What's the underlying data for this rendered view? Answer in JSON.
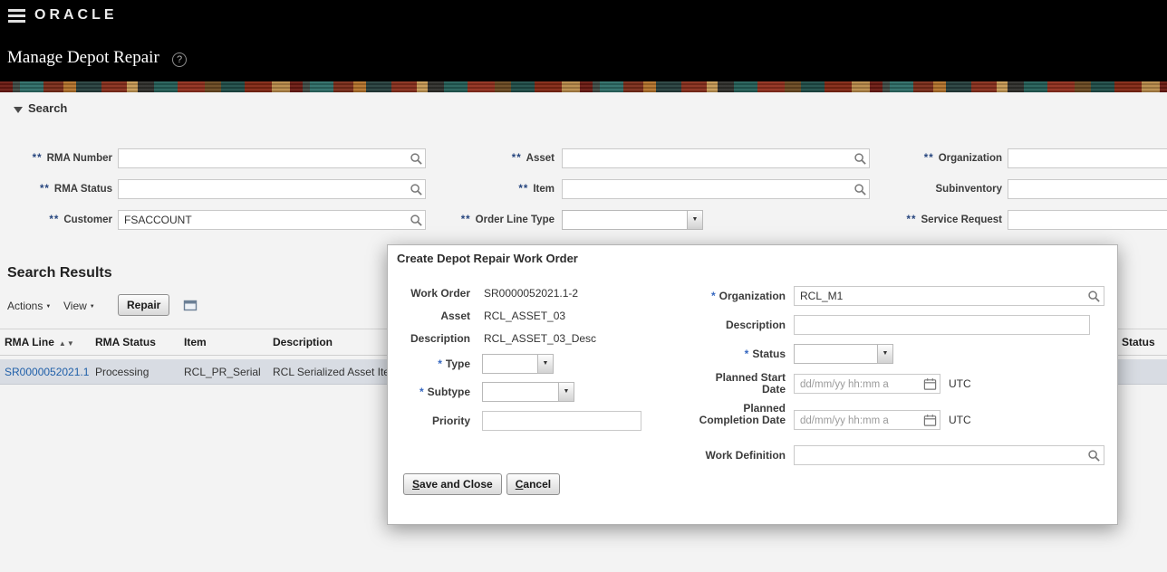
{
  "icons": {
    "help": "?",
    "sort_asc": "▲",
    "sort_desc": "▼",
    "dropdown_arrow": "▼",
    "menu_arrow": "▼"
  },
  "topbar": {
    "brand": "ORACLE"
  },
  "header": {
    "title": "Manage Depot Repair"
  },
  "search": {
    "title": "Search",
    "fields": {
      "rma_number": {
        "marker": "**",
        "label": "RMA Number",
        "value": ""
      },
      "rma_status": {
        "marker": "**",
        "label": "RMA Status",
        "value": ""
      },
      "customer": {
        "marker": "**",
        "label": "Customer",
        "value": "FSACCOUNT"
      },
      "asset": {
        "marker": "**",
        "label": "Asset",
        "value": ""
      },
      "item": {
        "marker": "**",
        "label": "Item",
        "value": ""
      },
      "order_line_type": {
        "marker": "**",
        "label": "Order Line Type",
        "value": ""
      },
      "organization": {
        "marker": "**",
        "label": "Organization",
        "value": ""
      },
      "subinventory": {
        "marker": "",
        "label": "Subinventory",
        "value": ""
      },
      "service_request": {
        "marker": "**",
        "label": "Service Request",
        "value": ""
      }
    }
  },
  "results": {
    "title": "Search Results",
    "toolbar": {
      "actions": "Actions",
      "view": "View",
      "repair": "Repair"
    },
    "table": {
      "headers": {
        "rma_line": "RMA Line",
        "rma_status": "RMA Status",
        "item": "Item",
        "description": "Description",
        "status": "Status"
      },
      "row": {
        "rma_line": "SR0000052021.1",
        "rma_status": "Processing",
        "item": "RCL_PR_Serial",
        "description": "RCL Serialized Asset Item"
      }
    }
  },
  "dialog": {
    "title": "Create Depot Repair Work Order",
    "work_order": {
      "label": "Work Order",
      "value": "SR0000052021.1-2"
    },
    "asset": {
      "label": "Asset",
      "value": "RCL_ASSET_03"
    },
    "description": {
      "label": "Description",
      "value": "RCL_ASSET_03_Desc"
    },
    "type": {
      "marker": "*",
      "label": "Type"
    },
    "subtype": {
      "marker": "*",
      "label": "Subtype"
    },
    "priority": {
      "label": "Priority",
      "value": ""
    },
    "organization": {
      "marker": "*",
      "label": "Organization",
      "value": "RCL_M1"
    },
    "description_field": {
      "label": "Description",
      "value": ""
    },
    "status": {
      "marker": "*",
      "label": "Status"
    },
    "planned_start": {
      "label": "Planned Start Date",
      "placeholder": "dd/mm/yy hh:mm a",
      "timezone": "UTC"
    },
    "planned_completion": {
      "label": "Planned Completion Date",
      "placeholder": "dd/mm/yy hh:mm a",
      "timezone": "UTC"
    },
    "work_definition": {
      "label": "Work Definition",
      "value": ""
    },
    "buttons": {
      "save_key": "S",
      "save_rest": "ave and Close",
      "cancel_key": "C",
      "cancel_rest": "ancel"
    }
  }
}
